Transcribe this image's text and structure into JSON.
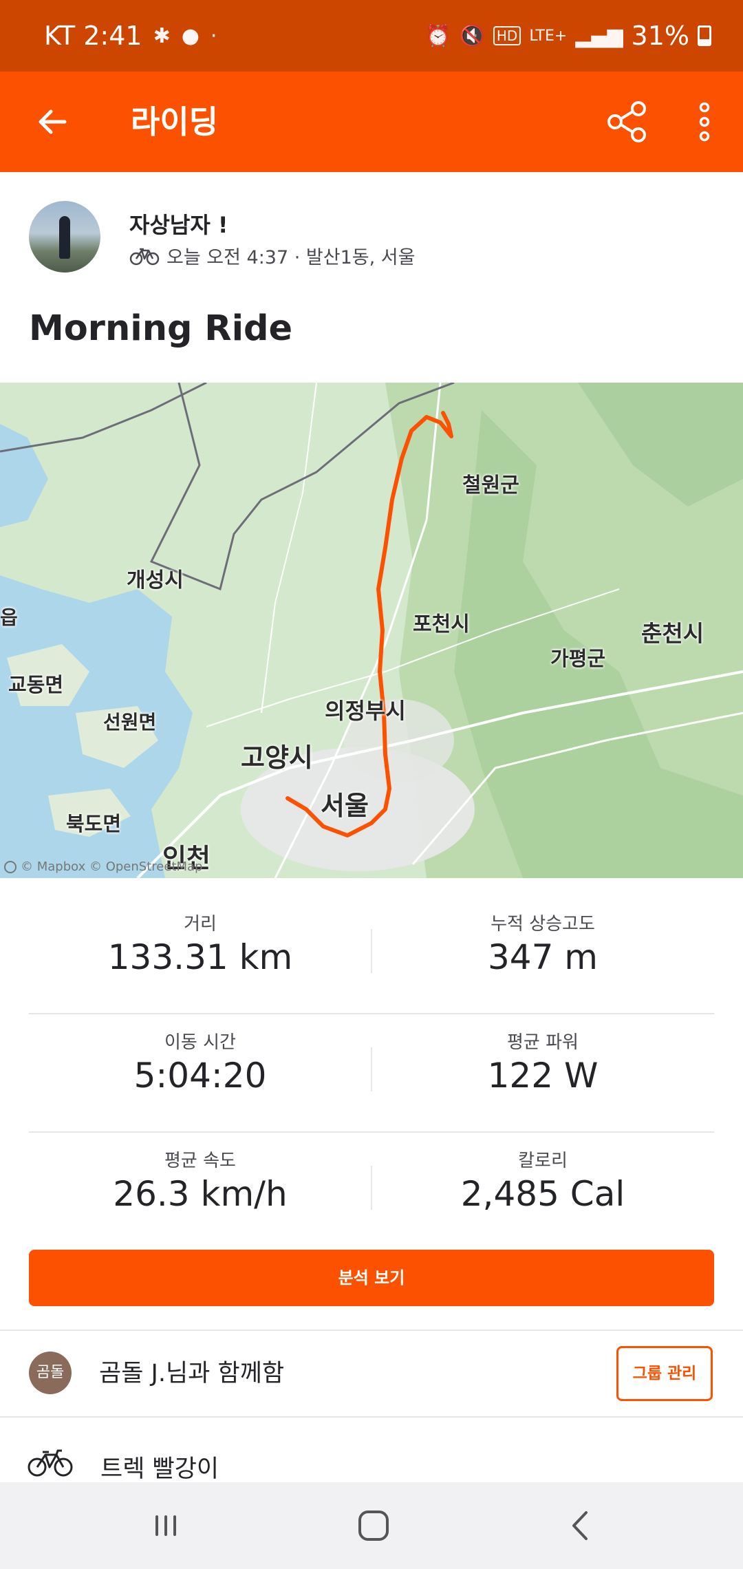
{
  "status_bar": {
    "carrier_time": "KT 2:41",
    "network": "LTE+",
    "battery": "31%",
    "hd_label": "HD"
  },
  "app_bar": {
    "title": "라이딩",
    "back_icon": "arrow-left-icon",
    "share_icon": "share-icon",
    "more_icon": "more-vertical-icon"
  },
  "athlete": {
    "name": "자상남자 !",
    "activity_meta": "오늘 오전 4:37 · 발산1동, 서울",
    "activity_icon": "bike-icon"
  },
  "activity": {
    "title": "Morning Ride"
  },
  "map": {
    "labels": [
      "철원군",
      "개성시",
      "포천시",
      "춘천시",
      "가평군",
      "교동면",
      "의정부시",
      "선원면",
      "고양시",
      "서울",
      "북도면",
      "인천",
      "읍"
    ],
    "attribution": "© Mapbox © OpenStreetMap",
    "route_color": "#fc5200"
  },
  "stats": [
    {
      "label": "거리",
      "value": "133.31 km"
    },
    {
      "label": "누적 상승고도",
      "value": "347 m"
    },
    {
      "label": "이동 시간",
      "value": "5:04:20"
    },
    {
      "label": "평균 파워",
      "value": "122 W"
    },
    {
      "label": "평균 속도",
      "value": "26.3 km/h"
    },
    {
      "label": "칼로리",
      "value": "2,485 Cal"
    }
  ],
  "analysis_button": "분석 보기",
  "group": {
    "avatar_text": "곰돌",
    "text": "곰돌 J.님과 함께함",
    "button": "그룹 관리"
  },
  "gear": {
    "text": "트렉 빨강이",
    "icon": "bike-icon"
  },
  "nav_bar": {
    "recents_icon": "recents-icon",
    "home_icon": "home-icon",
    "back_icon": "back-chevron-icon"
  },
  "colors": {
    "brand": "#fc5200",
    "status_bar": "#cc4600"
  }
}
